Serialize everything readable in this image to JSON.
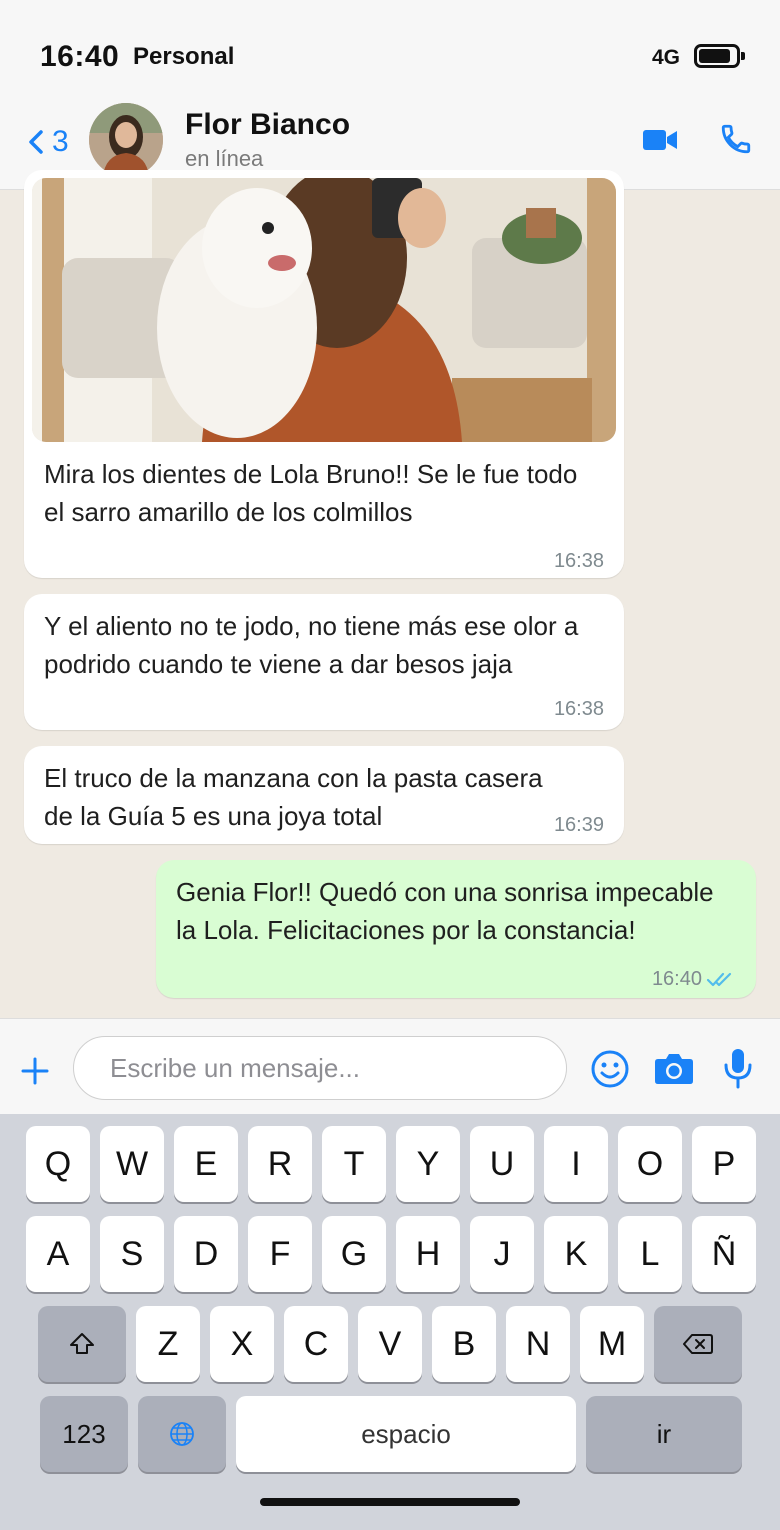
{
  "status_bar": {
    "time": "16:40",
    "carrier": "Personal",
    "network": "4G"
  },
  "header": {
    "back_count": "3",
    "contact_name": "Flor Bianco",
    "contact_status": "en línea"
  },
  "messages": [
    {
      "direction": "in",
      "type": "photo",
      "text": "Mira los dientes de Lola Bruno!! Se le fue todo el sarro amarillo de los colmillos",
      "time": "16:38"
    },
    {
      "direction": "in",
      "type": "text",
      "text": "Y el aliento no te jodo, no tiene más ese olor a podrido cuando te viene a dar besos jaja",
      "time": "16:38"
    },
    {
      "direction": "in",
      "type": "text",
      "text": "El truco de la manzana con la pasta casera de la Guía 5 es una joya total",
      "time": "16:39"
    },
    {
      "direction": "out",
      "type": "text",
      "text": "Genia Flor!! Quedó con una sonrisa impecable la Lola. Felicitaciones por la constancia!",
      "time": "16:40",
      "status": "read"
    }
  ],
  "composer": {
    "placeholder": "Escribe un mensaje...",
    "value": ""
  },
  "keyboard": {
    "row1": [
      "Q",
      "W",
      "E",
      "R",
      "T",
      "Y",
      "U",
      "I",
      "O",
      "P"
    ],
    "row2": [
      "A",
      "S",
      "D",
      "F",
      "G",
      "H",
      "J",
      "K",
      "L",
      "Ñ"
    ],
    "row3": [
      "Z",
      "X",
      "C",
      "V",
      "B",
      "N",
      "M"
    ],
    "numbers_key": "123",
    "space_key": "espacio",
    "return_key": "ir"
  },
  "colors": {
    "accent": "#1a82f7",
    "outgoing_bubble": "#d9fdd3",
    "incoming_bubble": "#ffffff",
    "chat_background": "#efeae2",
    "read_ticks": "#53bdeb"
  },
  "icons": [
    "back-chevron-icon",
    "video-call-icon",
    "phone-icon",
    "plus-icon",
    "emoji-icon",
    "camera-icon",
    "microphone-icon",
    "shift-icon",
    "backspace-icon",
    "globe-icon",
    "double-check-icon"
  ]
}
